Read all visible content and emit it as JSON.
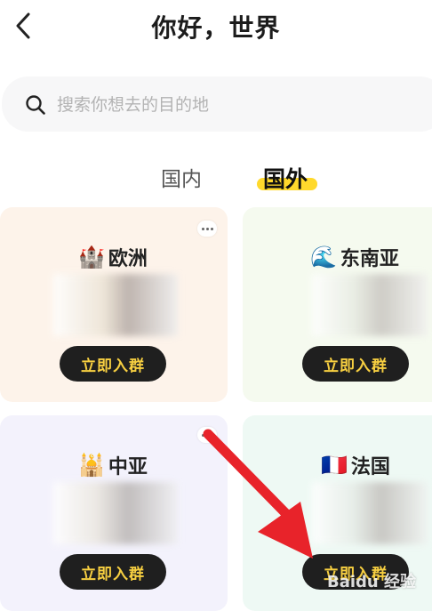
{
  "header": {
    "title": "你好，世界"
  },
  "search": {
    "placeholder": "搜索你想去的目的地"
  },
  "tabs": [
    {
      "label": "国内",
      "active": false
    },
    {
      "label": "国外",
      "active": true
    }
  ],
  "cards": [
    {
      "emoji": "🏰",
      "title": "欧洲",
      "button": "立即入群"
    },
    {
      "emoji": "🌊",
      "title": "东南亚",
      "button": "立即入群"
    },
    {
      "emoji": "🕌",
      "title": "中亚",
      "button": "立即入群"
    },
    {
      "emoji": "🇫🇷",
      "title": "法国",
      "button": "立即入群"
    }
  ],
  "watermark": "Baidu 经验",
  "colors": {
    "accent": "#ffd92c",
    "button_bg": "#1f1f1f",
    "button_text": "#f7cf41",
    "arrow": "#e8232a"
  }
}
